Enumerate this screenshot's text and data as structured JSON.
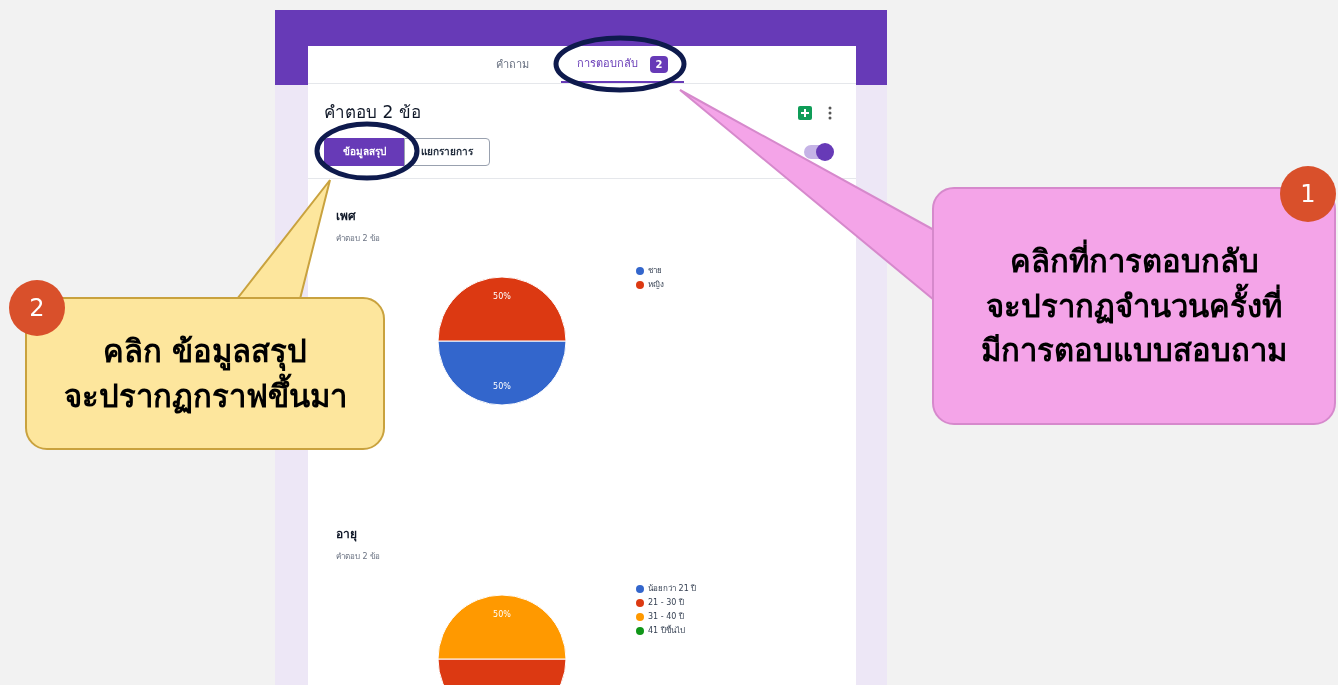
{
  "form": {
    "tabs": [
      {
        "label": "คำถาม",
        "selected": false
      },
      {
        "label": "การตอบกลับ",
        "selected": true,
        "badge": "2"
      }
    ],
    "heading": "คำตอบ 2 ข้อ",
    "views": [
      {
        "label": "ข้อมูลสรุป",
        "selected": true
      },
      {
        "label": "แยกรายการ",
        "selected": false
      }
    ],
    "accepting_toggle": {
      "on": true
    },
    "questions": [
      {
        "title": "เพศ",
        "count": "คำตอบ 2 ข้อ",
        "chart_data": {
          "type": "pie",
          "categories": [
            "ชาย",
            "หญิง"
          ],
          "series": [
            {
              "values": [
                50,
                50
              ]
            }
          ],
          "colors": [
            "#3366cc",
            "#dc3912"
          ],
          "value_labels": [
            "50%",
            "50%"
          ]
        }
      },
      {
        "title": "อายุ",
        "count": "คำตอบ 2 ข้อ",
        "chart_data": {
          "type": "pie",
          "categories": [
            "น้อยกว่า 21 ปี",
            "21 - 30 ปี",
            "31 - 40 ปี",
            "41 ปีขึ้นไป"
          ],
          "series": [
            {
              "values": [
                0,
                50,
                50,
                0
              ]
            }
          ],
          "colors": [
            "#3366cc",
            "#dc3912",
            "#ff9900",
            "#109618"
          ],
          "value_labels": [
            null,
            null,
            "50%",
            null
          ]
        }
      }
    ]
  },
  "callouts": [
    {
      "number": "1",
      "text": "คลิกที่การตอบกลับ\nจะปรากฏจำนวนครั้งที่\nมีการตอบแบบสอบถาม",
      "kind": "pink"
    },
    {
      "number": "2",
      "text": "คลิก ข้อมูลสรุป\nจะปรากฏกราฟขึ้นมา",
      "kind": "yellow"
    }
  ]
}
